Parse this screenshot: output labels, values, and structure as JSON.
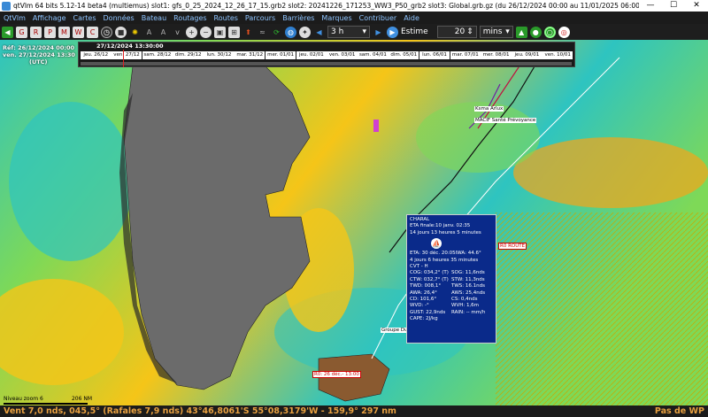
{
  "window": {
    "title": "qtVlm 64 bits 5.12-14 beta4 (multiemus) slot1: gfs_0_25_2024_12_26_17_15.grb2 slot2: 20241226_171253_WW3_P50_grb2 slot3: Global.grb.gz (du 26/12/2024 00:00 au 11/01/2025 06:00)",
    "controls": [
      "—",
      "☐",
      "✕"
    ]
  },
  "menu": [
    "QtVlm",
    "Affichage",
    "Cartes",
    "Données",
    "Bateau",
    "Routages",
    "Routes",
    "Parcours",
    "Barrières",
    "Marques",
    "Contribuer",
    "Aide"
  ],
  "toolbar": {
    "step_value": "3 h",
    "estime_label": "Estime",
    "estime_value": "20",
    "estime_unit": "mins"
  },
  "dates": {
    "ref": "Réf: 26/12/2024 00:00",
    "current": "ven. 27/12/2024 13:30",
    "utc": "(UTC)"
  },
  "timeline": {
    "cursor_label": "27/12/2024 13:30:00",
    "days": [
      "jeu. 26/12",
      "ven. 27/12",
      "sam. 28/12",
      "dim. 29/12",
      "lun. 30/12",
      "mar. 31/12",
      "mer. 01/01",
      "jeu. 02/01",
      "ven. 03/01",
      "sam. 04/01",
      "dim. 05/01",
      "lun. 06/01",
      "mar. 07/01",
      "mer. 08/01",
      "jeu. 09/01",
      "ven. 10/01",
      "sam. 11/01"
    ]
  },
  "map_labels": {
    "boat1": "Ksma Arlux",
    "boat2": "MACIF Santé Prévoyance",
    "group": "Groupe Du",
    "route": "R0 ROUTE",
    "route_end": "R0: 26 déc.- 13:00"
  },
  "popup": {
    "name": "CHARAL",
    "eta_final": "ETA finale:10 janv. 02:35",
    "eta_duration": "14 jours 13 heures 5 minutes",
    "eta2": "ETA: 30 déc. 20:05",
    "iwa": "IWA: 44.6°",
    "eta2_duration": "4 jours 6 heures 35 minutes",
    "position": "CVT - H",
    "rows": [
      [
        "COG: 034,2° (T)",
        "SOG: 11,6nds"
      ],
      [
        "CTW: 032,7° (T)",
        "STW: 11,3nds"
      ],
      [
        "TWD: 008,1°",
        "TWS: 16.1nds"
      ],
      [
        "AWA: 26,4°",
        "AWS: 25,4nds"
      ],
      [
        "CD: 101,6°",
        "CS: 0,4nds"
      ],
      [
        "WVD: -°",
        "WVH: 1,6m"
      ],
      [
        "GUST: 22,9nds",
        "RAIN: -- mm/h"
      ],
      [
        "CAPE: 2J/kg",
        ""
      ]
    ]
  },
  "scale": {
    "zoom": "Niveau zoom 6",
    "distance": "206 NM"
  },
  "status": {
    "left": "Vent 7,0 nds, 045,5° (Rafales 7,9 nds) 43°46,8061'S 55°08,3179'W - 159,9° 297 nm",
    "right": "Pas de WP"
  },
  "colors": {
    "ocean_cool": "#2ec4c0",
    "ocean_mid": "#7ed957",
    "ocean_warm": "#f5c518",
    "land": "#6b6b6b",
    "popup_bg": "#0a2a8a"
  }
}
